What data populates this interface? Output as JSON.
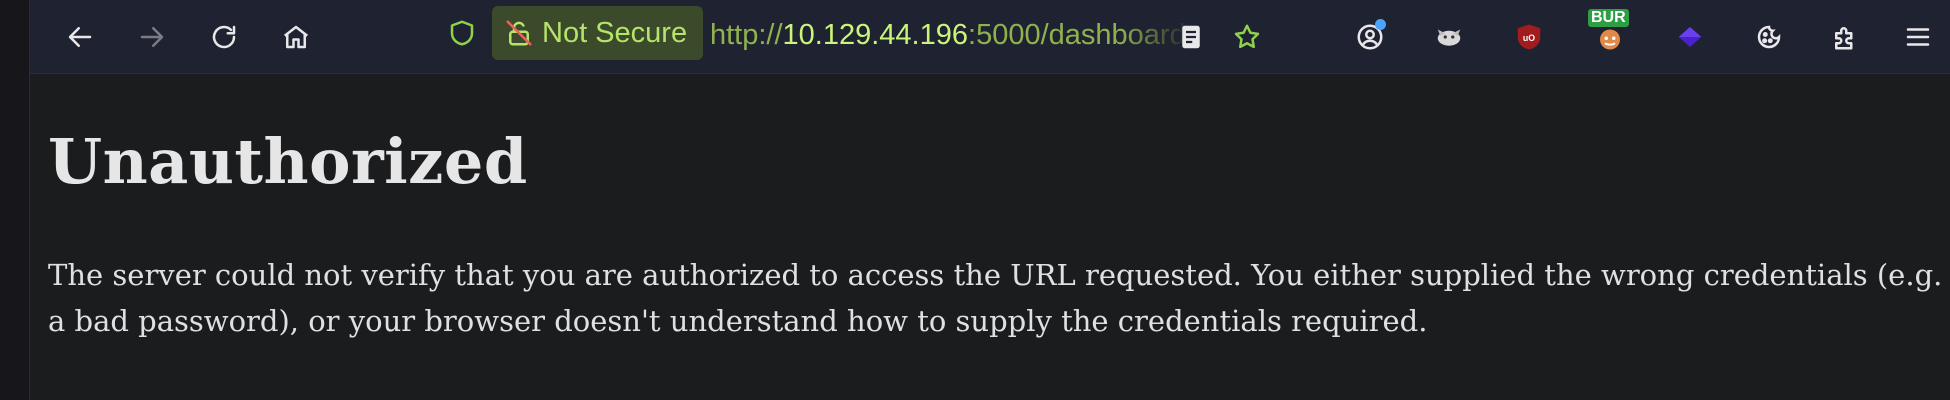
{
  "browser": {
    "security_label": "Not Secure",
    "url": {
      "protocol": "http://",
      "host": "10.129.44.196",
      "rest": ":5000/dashboard"
    },
    "extensions": {
      "bur_badge": "BUR"
    },
    "colors": {
      "toolbar_bg": "#1f2230",
      "security_bg": "#3a4a2a",
      "security_text": "#b6e36a",
      "page_bg": "#1a1c1e"
    }
  },
  "page": {
    "heading": "Unauthorized",
    "message": "The server could not verify that you are authorized to access the URL requested. You either supplied the wrong credentials (e.g. a bad password), or your browser doesn't understand how to supply the credentials required."
  }
}
